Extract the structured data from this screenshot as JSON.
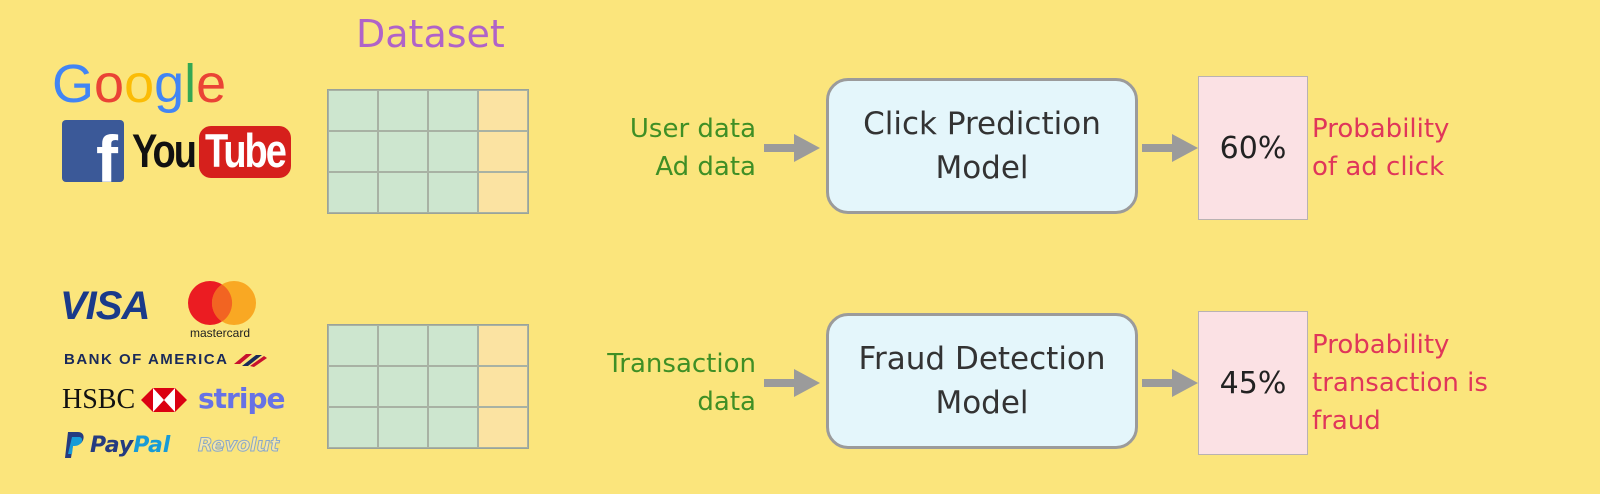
{
  "dataset_title": "Dataset",
  "logos_top": {
    "google": "Google",
    "facebook": "f",
    "youtube_you": "You",
    "youtube_tube": "Tube"
  },
  "logos_bottom": {
    "visa": "VISA",
    "mastercard": "mastercard",
    "bofa": "BANK OF AMERICA",
    "hsbc": "HSBC",
    "stripe": "stripe",
    "paypal_pay": "Pay",
    "paypal_pal": "Pal",
    "revolut": "Revolut"
  },
  "rows": [
    {
      "input_lines": [
        "User data",
        "Ad data"
      ],
      "model_lines": [
        "Click Prediction",
        "Model"
      ],
      "output_value": "60%",
      "output_label_lines": [
        "Probability",
        "of ad click"
      ]
    },
    {
      "input_lines": [
        "Transaction",
        "data"
      ],
      "model_lines": [
        "Fraud Detection",
        "Model"
      ],
      "output_value": "45%",
      "output_label_lines": [
        "Probability",
        "transaction is",
        "fraud"
      ]
    }
  ],
  "colors": {
    "background": "#fbe57c",
    "dataset_title": "#b063c8",
    "input_text": "#3f8f25",
    "model_fill": "#e4f6fb",
    "output_fill": "#fbe1e4",
    "output_label": "#e0365a",
    "feature_cell": "#cde6cf",
    "label_cell": "#fbe3a2",
    "arrow": "#9b9b9b"
  }
}
